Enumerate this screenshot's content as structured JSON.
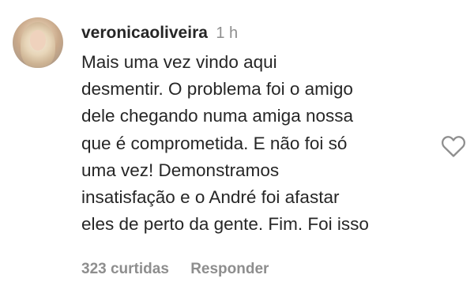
{
  "comment": {
    "username": "veronicaoliveira",
    "time": "1 h",
    "lines": [
      "Mais uma vez vindo aqui",
      "desmentir. O problema foi o amigo",
      "dele chegando numa amiga nossa",
      "que é comprometida. E não foi só",
      "uma vez! Demonstramos",
      "insatisfação e o André foi afastar",
      "eles de perto da gente. Fim. Foi isso"
    ],
    "likes": "323 curtidas",
    "reply_label": "Responder",
    "icons": {
      "like": "heart-outline-icon"
    },
    "colors": {
      "text": "#262626",
      "secondary": "#8e8e8e",
      "background": "#ffffff"
    }
  }
}
